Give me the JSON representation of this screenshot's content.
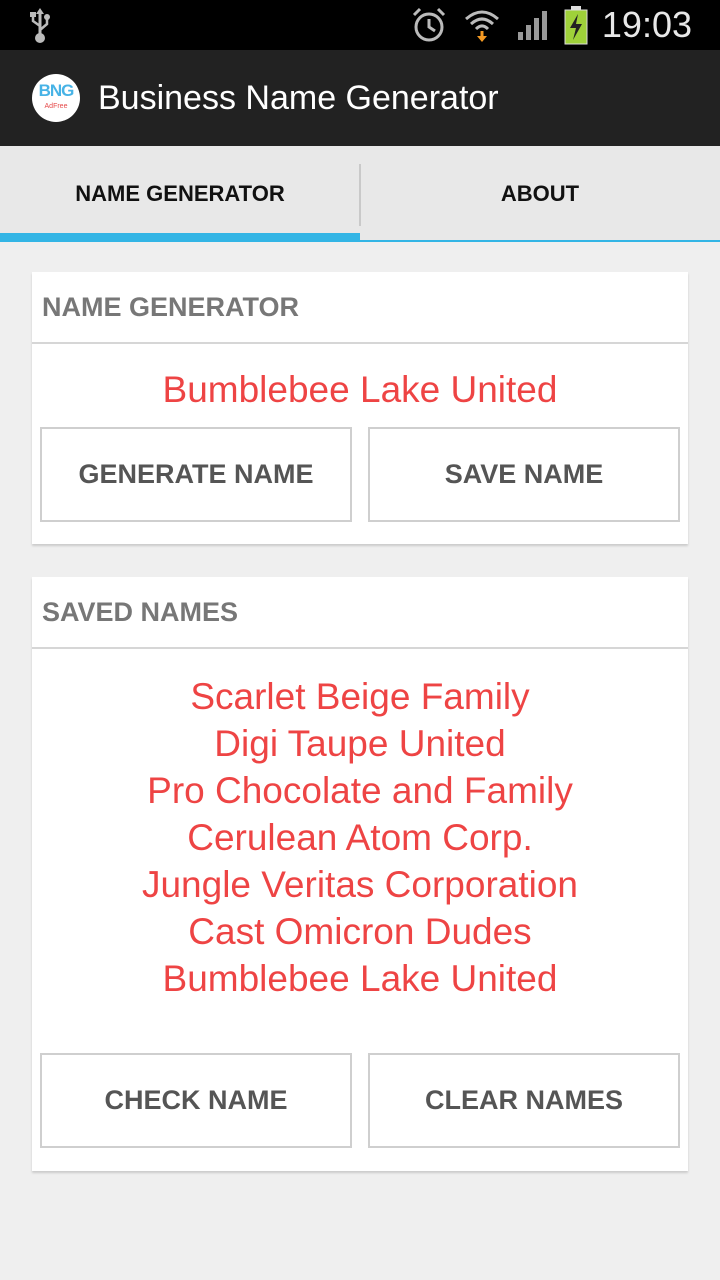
{
  "status_bar": {
    "time": "19:03",
    "icons": [
      "usb-icon",
      "alarm-icon",
      "wifi-icon",
      "signal-icon",
      "battery-charging-icon"
    ]
  },
  "app": {
    "title": "Business Name Generator",
    "icon_text": "BNG",
    "icon_subtext": "AdFree"
  },
  "tabs": [
    {
      "label": "NAME GENERATOR",
      "active": true
    },
    {
      "label": "ABOUT",
      "active": false
    }
  ],
  "generator_card": {
    "header": "NAME GENERATOR",
    "current_name": "Bumblebee Lake United",
    "generate_label": "GENERATE NAME",
    "save_label": "SAVE NAME"
  },
  "saved_card": {
    "header": "SAVED NAMES",
    "names": [
      "Scarlet Beige Family",
      "Digi Taupe United",
      "Pro Chocolate and Family",
      "Cerulean Atom Corp.",
      "Jungle Veritas Corporation",
      "Cast Omicron Dudes",
      "Bumblebee Lake United"
    ],
    "check_label": "CHECK NAME",
    "clear_label": "CLEAR NAMES"
  },
  "colors": {
    "accent": "#33b5e5",
    "name_text": "#ee4444",
    "action_bar": "#222222",
    "background": "#efefef"
  }
}
